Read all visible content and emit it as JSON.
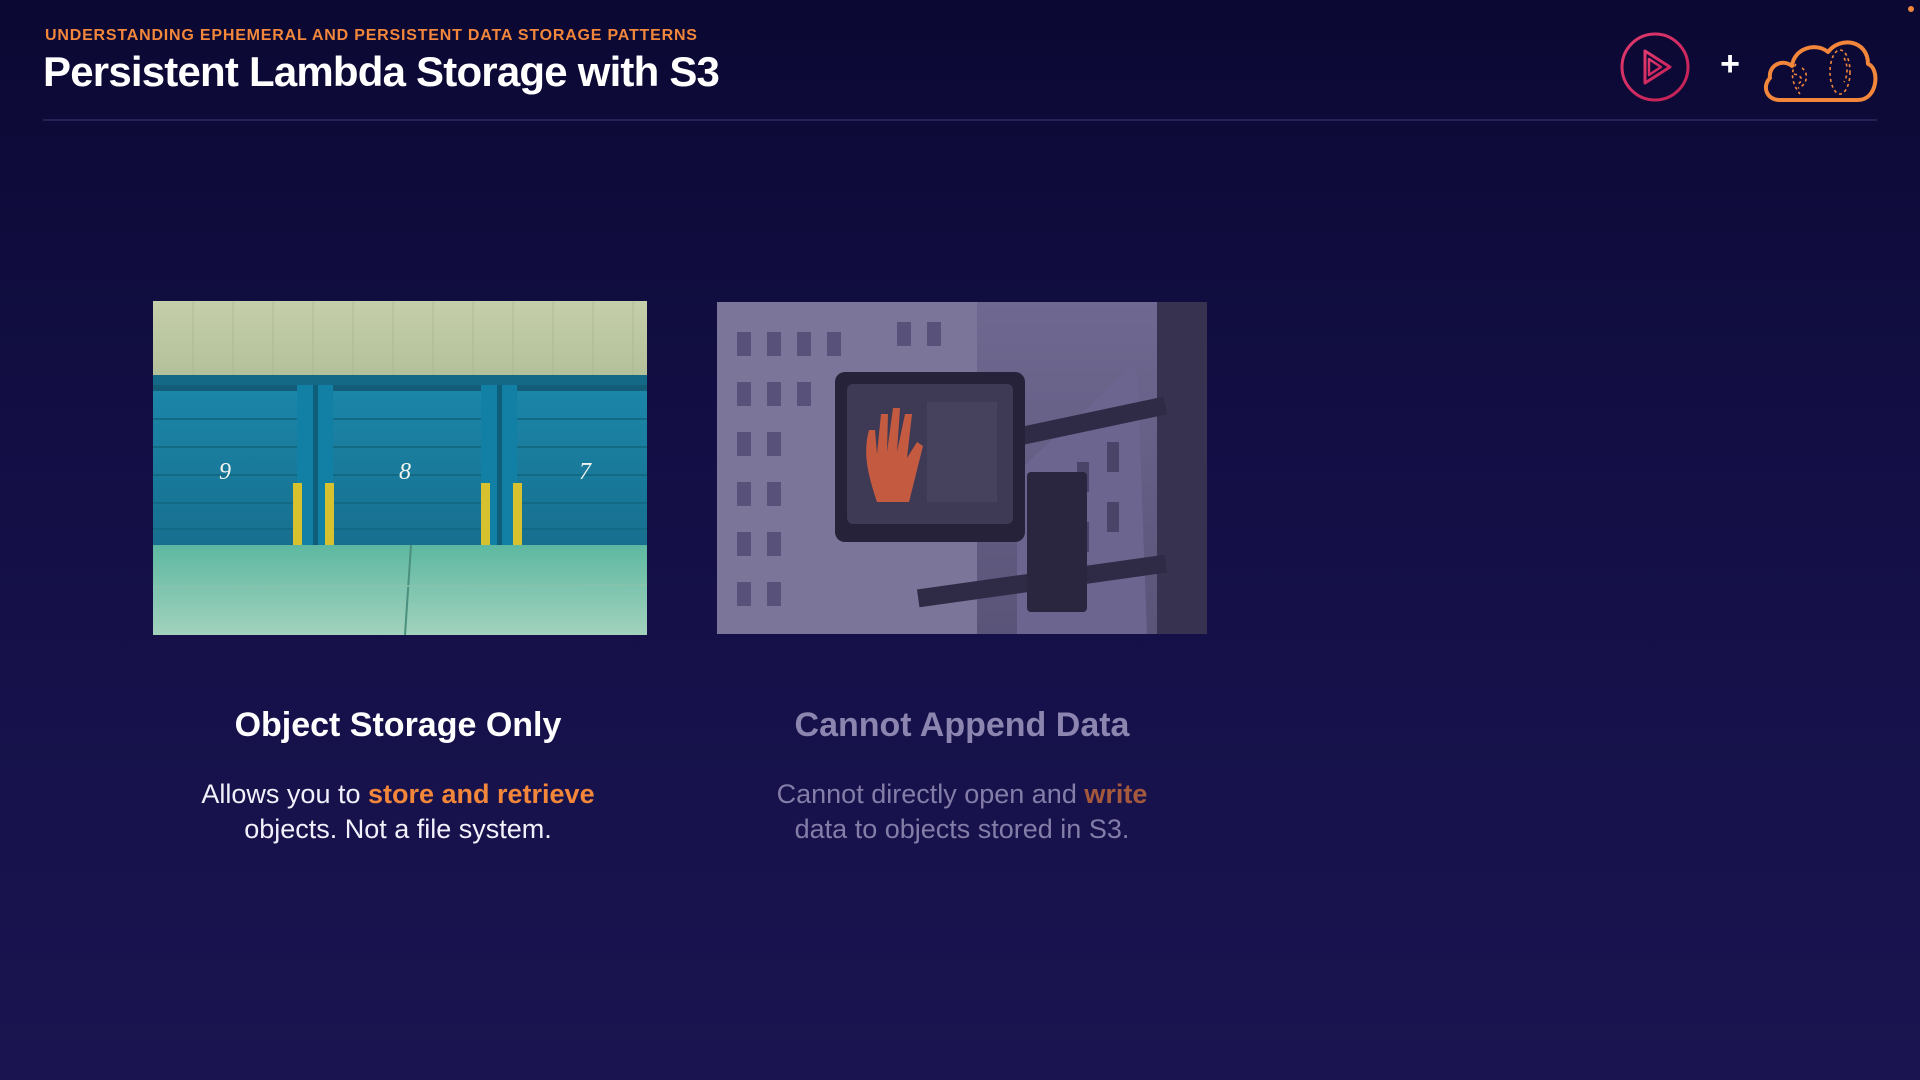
{
  "header": {
    "eyebrow": "UNDERSTANDING EPHEMERAL AND PERSISTENT DATA STORAGE PATTERNS",
    "title": "Persistent Lambda Storage with S3",
    "plus_sign": "+",
    "logos": [
      "play-logo-icon",
      "cloud-logo-icon"
    ]
  },
  "cards": [
    {
      "image": "storage-garage-doors-photo",
      "door_numbers": [
        "9",
        "8",
        "7"
      ],
      "title": "Object Storage Only",
      "desc_before": "Allows you to ",
      "desc_highlight": "store and retrieve",
      "desc_after": "objects. Not a file system."
    },
    {
      "image": "dont-walk-signal-photo",
      "title": "Cannot Append Data",
      "desc_before": "Cannot directly open and ",
      "desc_highlight": "write",
      "desc_after": "data to objects stored in S3."
    }
  ],
  "colors": {
    "accent": "#f2863a",
    "background": "#130f45",
    "dimmed_text": "#8b85b0"
  }
}
